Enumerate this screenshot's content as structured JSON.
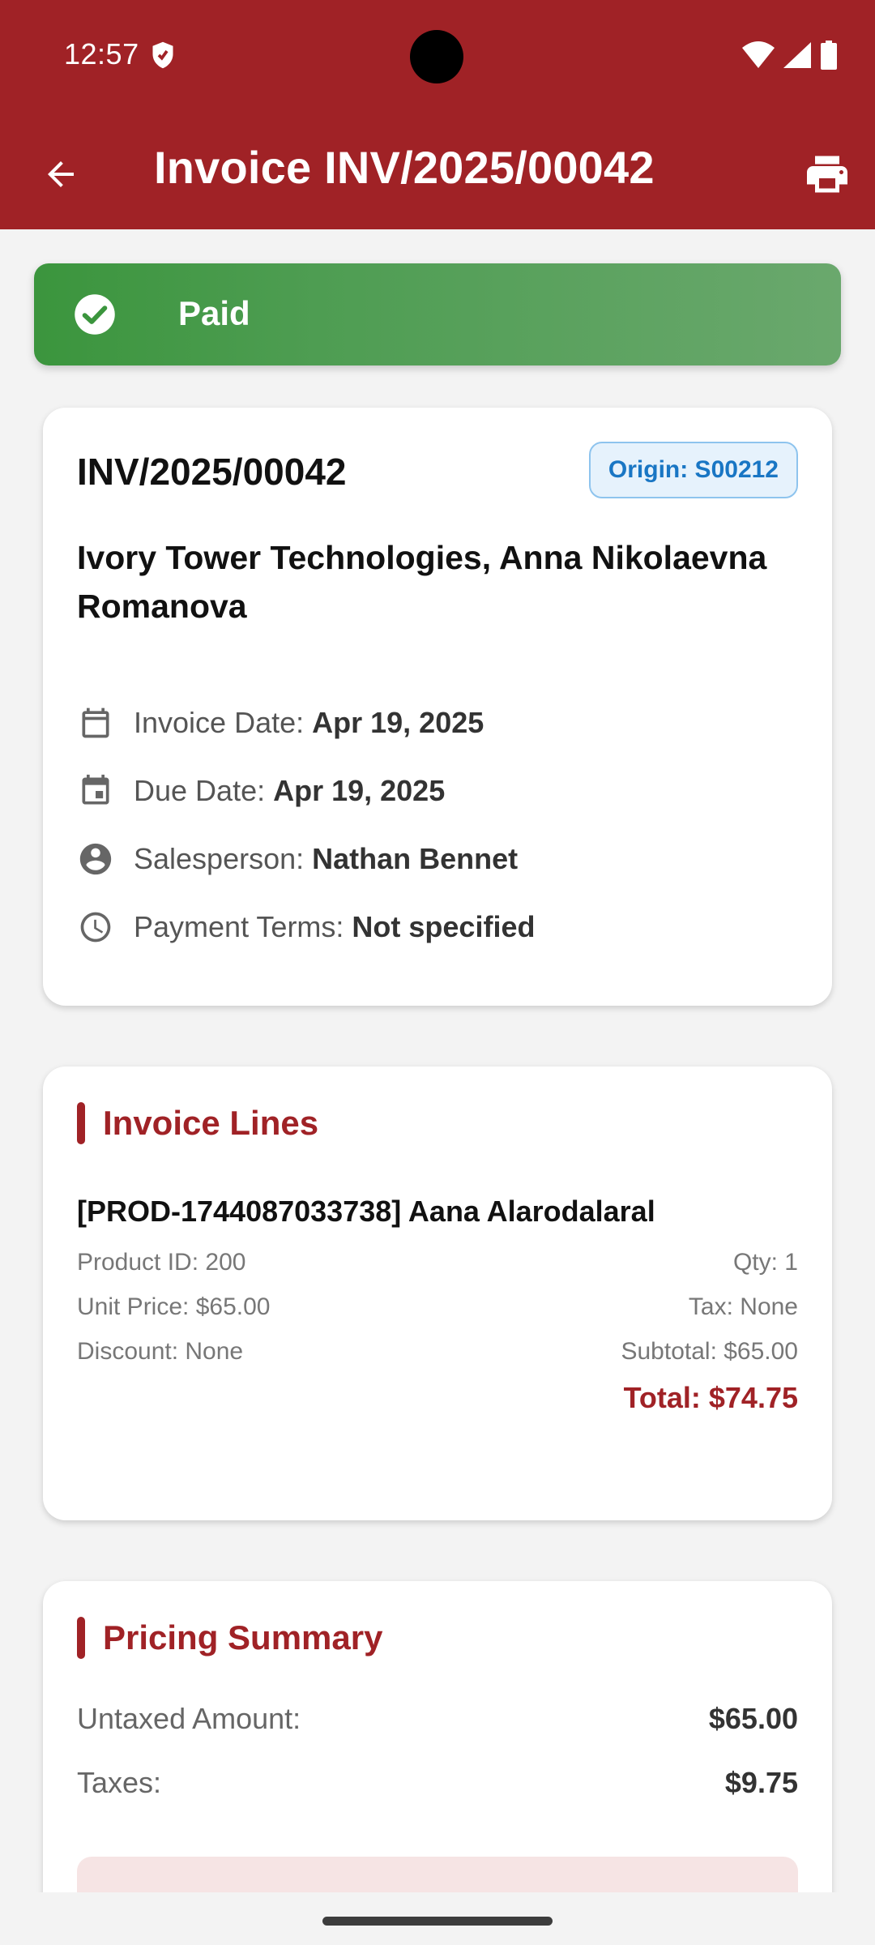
{
  "status_bar": {
    "time": "12:57"
  },
  "appbar": {
    "title": "Invoice INV/2025/00042"
  },
  "banner": {
    "status": "Paid"
  },
  "invoice": {
    "number": "INV/2025/00042",
    "origin": "Origin: S00212",
    "partner": "Ivory Tower Technologies, Anna Nikolaevna Romanova",
    "fields": [
      {
        "icon": "calendar-icon",
        "label": "Invoice Date:",
        "value": "Apr 19, 2025"
      },
      {
        "icon": "event-icon",
        "label": "Due Date:",
        "value": "Apr 19, 2025"
      },
      {
        "icon": "account-circle-icon",
        "label": "Salesperson:",
        "value": "Nathan Bennet"
      },
      {
        "icon": "clock-icon",
        "label": "Payment Terms:",
        "value": "Not specified"
      }
    ]
  },
  "lines": {
    "title": "Invoice Lines",
    "items": [
      {
        "name": "[PROD-1744087033738] Aana Alarodalaral",
        "product_id": "Product ID: 200",
        "qty": "Qty: 1",
        "unit_price": "Unit Price: $65.00",
        "tax": "Tax: None",
        "discount": "Discount: None",
        "subtotal": "Subtotal: $65.00",
        "total": "Total: $74.75"
      }
    ]
  },
  "summary": {
    "title": "Pricing Summary",
    "rows": [
      {
        "label": "Untaxed Amount:",
        "value": "$65.00"
      },
      {
        "label": "Taxes:",
        "value": "$9.75"
      }
    ]
  },
  "colors": {
    "primary": "#a02226",
    "paid": "#3b953d",
    "origin": "#1976c4"
  }
}
